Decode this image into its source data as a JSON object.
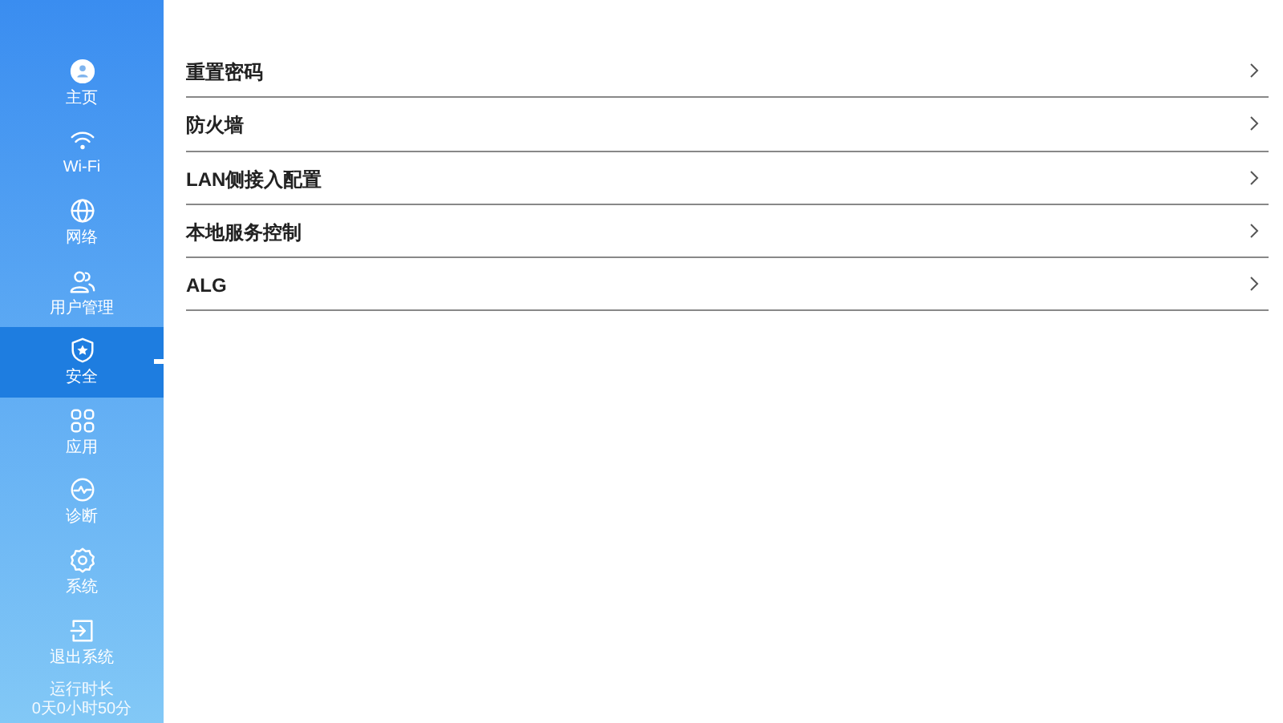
{
  "sidebar": {
    "items": [
      {
        "label": "主页",
        "selected": false
      },
      {
        "label": "Wi-Fi",
        "selected": false
      },
      {
        "label": "网络",
        "selected": false
      },
      {
        "label": "用户管理",
        "selected": false
      },
      {
        "label": "安全",
        "selected": true
      },
      {
        "label": "应用",
        "selected": false
      },
      {
        "label": "诊断",
        "selected": false
      },
      {
        "label": "系统",
        "selected": false
      },
      {
        "label": "退出系统",
        "selected": false
      }
    ],
    "uptime": {
      "label": "运行时长",
      "value": "0天0小时50分"
    }
  },
  "menu": {
    "items": [
      {
        "label": "重置密码"
      },
      {
        "label": "防火墙"
      },
      {
        "label": "LAN侧接入配置"
      },
      {
        "label": "本地服务控制"
      },
      {
        "label": "ALG"
      }
    ]
  }
}
